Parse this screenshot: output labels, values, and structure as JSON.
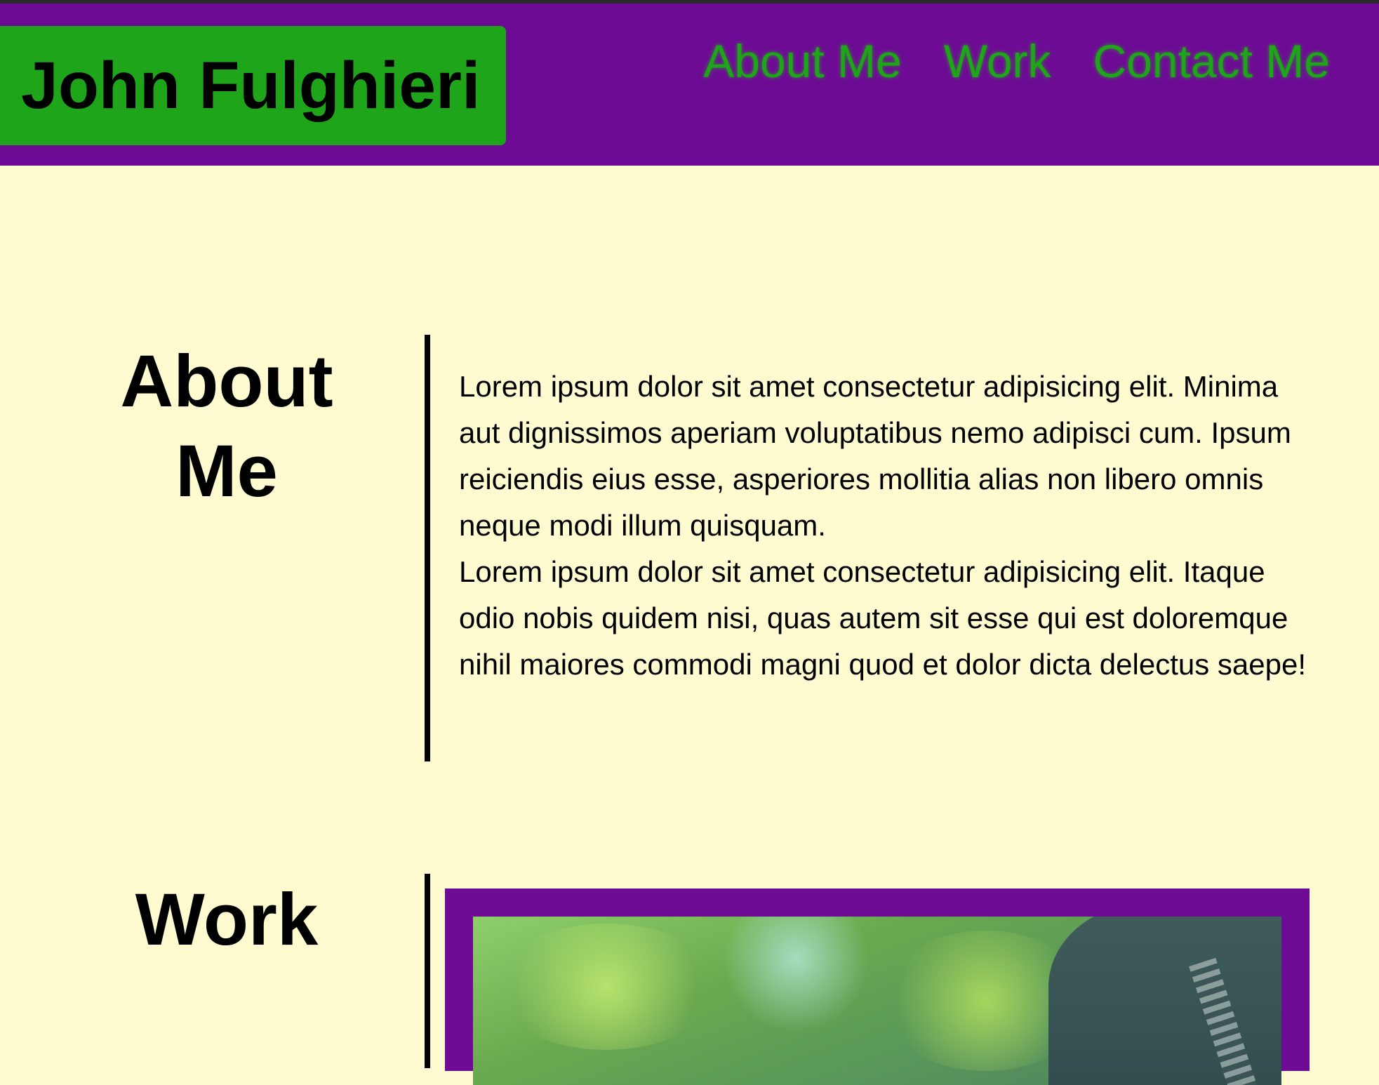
{
  "header": {
    "brand": "John Fulghieri",
    "nav": [
      {
        "label": "About Me"
      },
      {
        "label": "Work"
      },
      {
        "label": "Contact Me"
      }
    ]
  },
  "about": {
    "heading": "About Me",
    "paragraphs": [
      "Lorem ipsum dolor sit amet consectetur adipisicing elit. Minima aut dignissimos aperiam voluptatibus nemo adipisci cum. Ipsum reiciendis eius esse, asperiores mollitia alias non libero omnis neque modi illum quisquam.",
      "Lorem ipsum dolor sit amet consectetur adipisicing elit. Itaque odio nobis quidem nisi, quas autem sit esse qui est doloremque nihil maiores commodi magni quod et dolor dicta delectus saepe!"
    ]
  },
  "work": {
    "heading": "Work"
  },
  "colors": {
    "header_bg": "#6e0b95",
    "accent_green": "#1ea51a",
    "page_bg": "#fffbd0"
  }
}
